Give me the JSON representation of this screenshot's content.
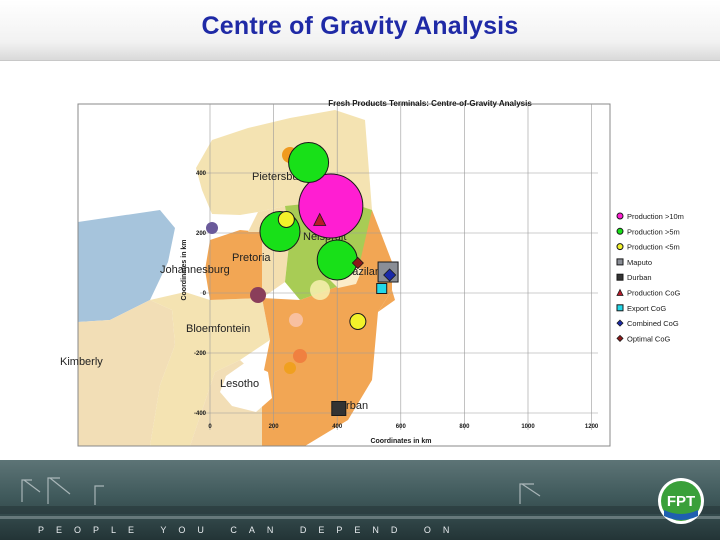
{
  "slide": {
    "title": "Centre of Gravity Analysis",
    "tagline": "PEOPLE YOU CAN DEPEND ON",
    "logo_text": "FPT"
  },
  "map_labels": {
    "pietersburg": "Pietersburg",
    "nelspruit": "Nelspruit",
    "pretoria": "Pretoria",
    "johannesburg": "Johannesburg",
    "swaziland": "Swaziland",
    "bloemfontein": "Bloemfontein",
    "kimberly": "Kimberly",
    "lesotho": "Lesotho",
    "durban": "Durban"
  },
  "colors": {
    "title": "#1f2aa6",
    "production": "#18e018",
    "production_large": "#ff1ed2",
    "production_small": "#f2f22a",
    "maputo": "#8a8e96",
    "durban": "#333333",
    "production_cog": "#b81a2a",
    "export_cog": "#22d8e8",
    "combined_cog": "#1a2aa8",
    "optimal_cog": "#8b1a1a"
  },
  "chart_data": {
    "type": "scatter",
    "title": "Fresh Products Terminals: Centre-of-Gravity Analysis",
    "xlabel": "Coordinates in km",
    "ylabel": "Coordinates in km",
    "xlim": [
      0,
      1200
    ],
    "ylim": [
      -400,
      400
    ],
    "xticks": [
      "0",
      "200",
      "400",
      "600",
      "800",
      "1000",
      "1200"
    ],
    "yticks": [
      "400",
      "200",
      "0",
      "-200",
      "-400"
    ],
    "grid": true,
    "legend_position": "right",
    "legend": [
      {
        "label": "Production >10m",
        "symbol": "circle",
        "color": "#ff1ed2"
      },
      {
        "label": "Production >5m",
        "symbol": "circle",
        "color": "#18e018"
      },
      {
        "label": "Production <5m",
        "symbol": "circle",
        "color": "#f2f22a"
      },
      {
        "label": "Maputo",
        "symbol": "square",
        "color": "#8a8e96"
      },
      {
        "label": "Durban",
        "symbol": "square",
        "color": "#333333"
      },
      {
        "label": "Production CoG",
        "symbol": "triangle",
        "color": "#b81a2a"
      },
      {
        "label": "Export CoG",
        "symbol": "square",
        "color": "#22d8e8"
      },
      {
        "label": "Combined CoG",
        "symbol": "diamond",
        "color": "#1a2aa8"
      },
      {
        "label": "Optimal CoG",
        "symbol": "diamond",
        "color": "#8b1a1a"
      }
    ],
    "series": [
      {
        "name": "Production >10m",
        "points": [
          {
            "x": 380,
            "y": 290
          }
        ]
      },
      {
        "name": "Production >5m",
        "points": [
          {
            "x": 310,
            "y": 435
          },
          {
            "x": 220,
            "y": 205
          },
          {
            "x": 400,
            "y": 110
          }
        ]
      },
      {
        "name": "Production <5m",
        "points": [
          {
            "x": 240,
            "y": 245
          },
          {
            "x": 465,
            "y": -95
          }
        ]
      },
      {
        "name": "Maputo",
        "points": [
          {
            "x": 560,
            "y": 70
          }
        ]
      },
      {
        "name": "Durban",
        "points": [
          {
            "x": 405,
            "y": -385
          }
        ]
      },
      {
        "name": "Production CoG",
        "points": [
          {
            "x": 345,
            "y": 245
          }
        ]
      },
      {
        "name": "Export CoG",
        "points": [
          {
            "x": 540,
            "y": 15
          }
        ]
      },
      {
        "name": "Combined CoG",
        "points": [
          {
            "x": 565,
            "y": 60
          }
        ]
      },
      {
        "name": "Optimal CoG",
        "points": [
          {
            "x": 465,
            "y": 100
          }
        ]
      }
    ]
  }
}
